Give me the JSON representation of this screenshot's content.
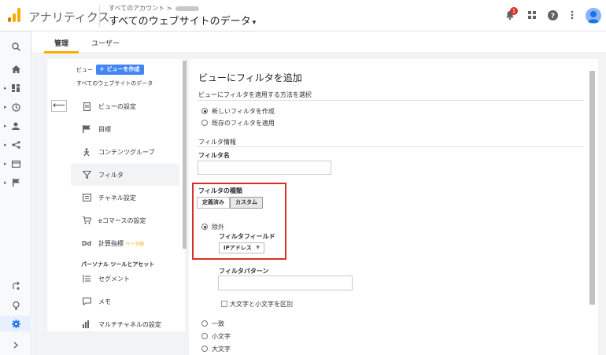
{
  "header": {
    "app_name": "アナリティクス",
    "breadcrumb": "すべてのアカウント >",
    "account_title": "すべてのウェブサイトのデータ",
    "notification_count": "1"
  },
  "tabs": {
    "admin": "管理",
    "user": "ユーザー"
  },
  "admin_nav": {
    "view_label": "ビュー",
    "create_view_button": "ビューを作成",
    "view_name": "すべてのウェブサイトのデータ",
    "items": [
      {
        "label": "ビューの設定",
        "icon": "document-icon"
      },
      {
        "label": "目標",
        "icon": "flag-icon"
      },
      {
        "label": "コンテンツグループ",
        "icon": "person-walk-icon"
      },
      {
        "label": "フィルタ",
        "icon": "filter-icon"
      },
      {
        "label": "チャネル設定",
        "icon": "channel-icon"
      },
      {
        "label": "eコマースの設定",
        "icon": "cart-icon"
      },
      {
        "label": "計算指標",
        "icon": "dd-icon",
        "badge": "ベータ版"
      }
    ],
    "section_heading": "パーソナル ツールとアセット",
    "tools": [
      {
        "label": "セグメント",
        "icon": "segment-icon"
      },
      {
        "label": "メモ",
        "icon": "comment-icon"
      },
      {
        "label": "マルチチャネルの設定",
        "icon": "bar-chart-icon"
      }
    ]
  },
  "form": {
    "title": "ビューにフィルタを追加",
    "method_label": "ビューにフィルタを適用する方法を選択",
    "method_options": [
      "新しいフィルタを作成",
      "既存のフィルタを適用"
    ],
    "filter_info_label": "フィルタ情報",
    "filter_name_label": "フィルタ名",
    "filter_name_value": "",
    "filter_type_label": "フィルタの種類",
    "filter_type_tabs": [
      "定義済み",
      "カスタム"
    ],
    "exclude_label": "除外",
    "filter_field_label": "フィルタフィールド",
    "filter_field_value": "IPアドレス",
    "filter_pattern_label": "フィルタパターン",
    "filter_pattern_value": "",
    "case_sensitive_label": "大文字と小文字を区別",
    "other_options": [
      "一致",
      "小文字",
      "大文字"
    ]
  },
  "footer": {
    "copyright": "©"
  },
  "colors": {
    "accent": "#1a73e8",
    "brand_orange": "#f9ab00",
    "highlight_red": "#d93025",
    "create_button": "#4285f4"
  }
}
